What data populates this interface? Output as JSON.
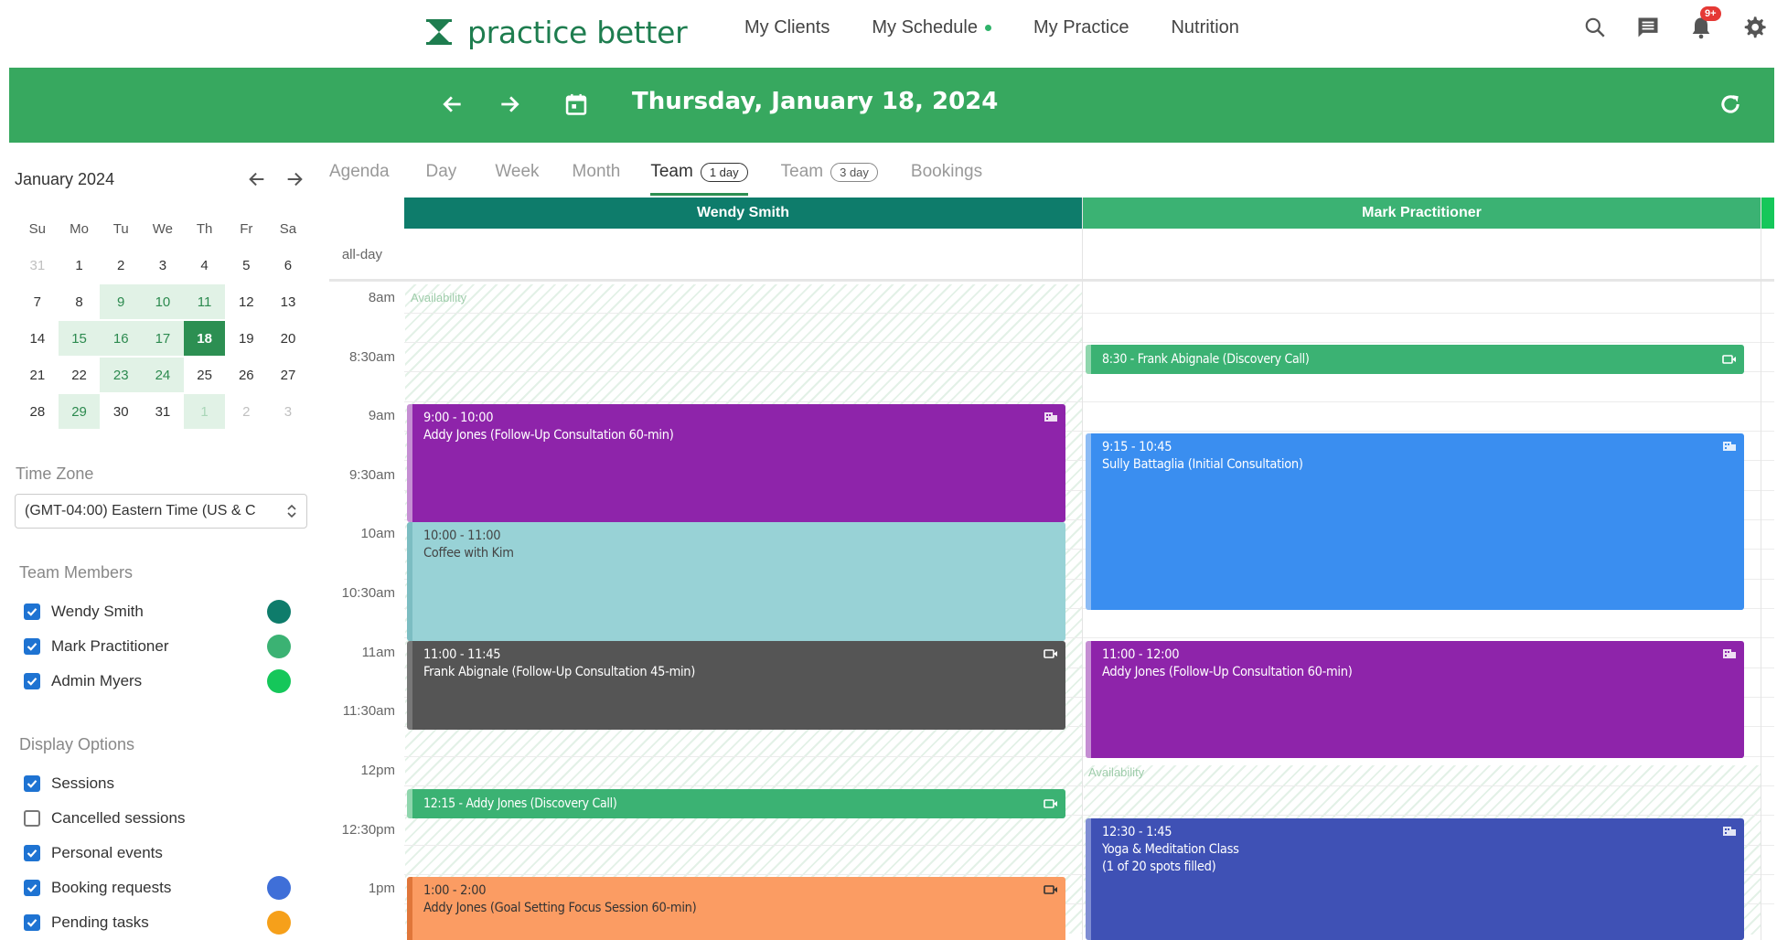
{
  "brand": {
    "name": "practice better"
  },
  "nav": {
    "links": [
      "My Clients",
      "My Schedule",
      "My Practice",
      "Nutrition"
    ],
    "notification_badge": "9+"
  },
  "header": {
    "date": "Thursday, January 18, 2024"
  },
  "mini_calendar": {
    "title": "January 2024",
    "weekdays": [
      "Su",
      "Mo",
      "Tu",
      "We",
      "Th",
      "Fr",
      "Sa"
    ],
    "weeks": [
      [
        "31",
        "1",
        "2",
        "3",
        "4",
        "5",
        "6"
      ],
      [
        "7",
        "8",
        "9",
        "10",
        "11",
        "12",
        "13"
      ],
      [
        "14",
        "15",
        "16",
        "17",
        "18",
        "19",
        "20"
      ],
      [
        "21",
        "22",
        "23",
        "24",
        "25",
        "26",
        "27"
      ],
      [
        "28",
        "29",
        "30",
        "31",
        "1",
        "2",
        "3"
      ]
    ],
    "selected": "18"
  },
  "sidebar": {
    "time_zone_label": "Time Zone",
    "time_zone_value": "(GMT-04:00) Eastern Time (US & C",
    "team_label": "Team Members",
    "team": [
      {
        "name": "Wendy Smith",
        "checked": true,
        "color": "#0e7c6b"
      },
      {
        "name": "Mark Practitioner",
        "checked": true,
        "color": "#3bb273"
      },
      {
        "name": "Admin Myers",
        "checked": true,
        "color": "#15c75a"
      }
    ],
    "display_label": "Display Options",
    "display": [
      {
        "name": "Sessions",
        "checked": true,
        "color": ""
      },
      {
        "name": "Cancelled sessions",
        "checked": false,
        "color": ""
      },
      {
        "name": "Personal events",
        "checked": true,
        "color": ""
      },
      {
        "name": "Booking requests",
        "checked": true,
        "color": "#3f6fd8"
      },
      {
        "name": "Pending tasks",
        "checked": true,
        "color": "#f6a01a"
      }
    ]
  },
  "tabs": [
    {
      "label": "Agenda",
      "pill": "",
      "active": false
    },
    {
      "label": "Day",
      "pill": "",
      "active": false
    },
    {
      "label": "Week",
      "pill": "",
      "active": false
    },
    {
      "label": "Month",
      "pill": "",
      "active": false
    },
    {
      "label": "Team",
      "pill": "1 day",
      "active": true
    },
    {
      "label": "Team",
      "pill": "3 day",
      "active": false
    },
    {
      "label": "Bookings",
      "pill": "",
      "active": false
    }
  ],
  "calendar": {
    "allday_label": "all-day",
    "time_labels": [
      "8am",
      "8:30am",
      "9am",
      "9:30am",
      "10am",
      "10:30am",
      "11am",
      "11:30am",
      "12pm",
      "12:30pm",
      "1pm"
    ],
    "columns": [
      {
        "name": "Wendy Smith",
        "color": "#0e7c6b"
      },
      {
        "name": "Mark Practitioner",
        "color": "#3bb273"
      }
    ],
    "availability_label": "Availability",
    "events": {
      "w1": {
        "time": "9:00 - 10:00",
        "title": "Addy Jones (Follow-Up Consultation 60-min)",
        "color": "#8e24aa"
      },
      "w2": {
        "time": "10:00 - 11:00",
        "title": "Coffee with Kim",
        "color": "#98d2d6"
      },
      "w3": {
        "time": "11:00 - 11:45",
        "title": "Frank Abignale (Follow-Up Consultation 45-min)",
        "color": "#555555"
      },
      "w4": {
        "text": "12:15 - Addy Jones (Discovery Call)",
        "color": "#3bb273"
      },
      "w5": {
        "time": "1:00 - 2:00",
        "title": "Addy Jones (Goal Setting Focus Session 60-min)",
        "color": "#fb9c63"
      },
      "m1": {
        "text": "8:30 - Frank Abignale (Discovery Call)",
        "color": "#3bb273"
      },
      "m2": {
        "time": "9:15 - 10:45",
        "title": "Sully Battaglia (Initial Consultation)",
        "color": "#3a8ef0"
      },
      "m3": {
        "time": "11:00 - 12:00",
        "title": "Addy Jones (Follow-Up Consultation 60-min)",
        "color": "#8e24aa"
      },
      "m4": {
        "time": "12:30 - 1:45",
        "title": "Yoga & Meditation Class",
        "extra": "(1 of 20 spots filled)",
        "color": "#3f51b5"
      }
    }
  }
}
